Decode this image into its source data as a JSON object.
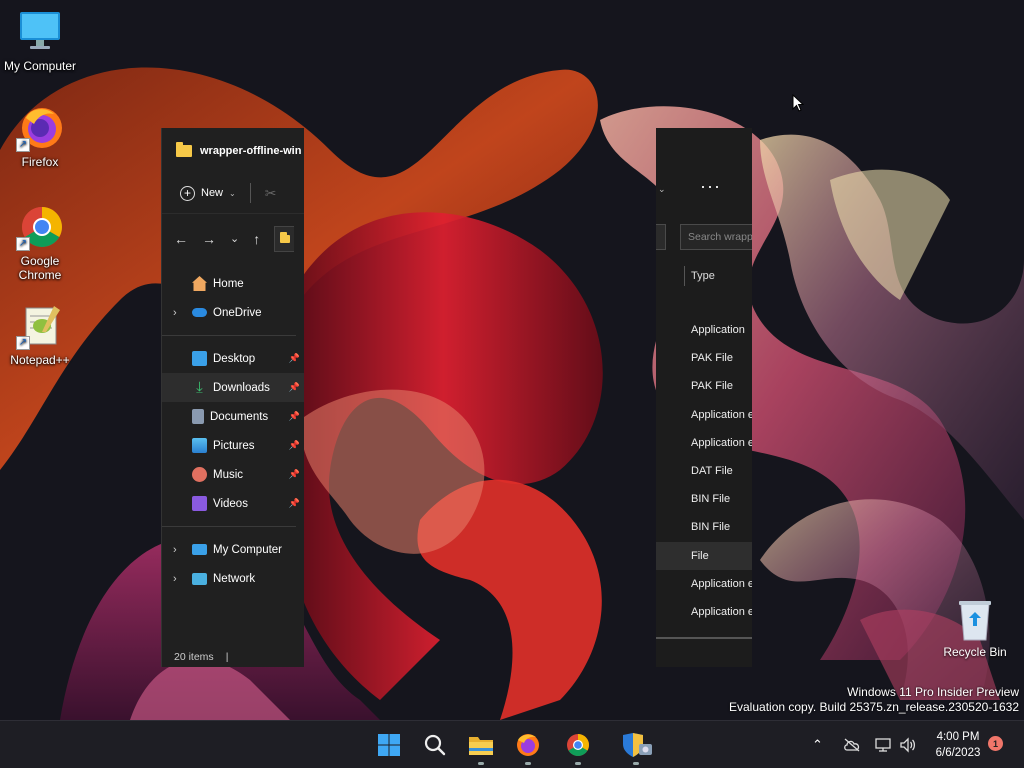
{
  "desktop": {
    "icons": [
      {
        "label": "My Computer"
      },
      {
        "label": "Firefox"
      },
      {
        "label": "Google\nChrome"
      },
      {
        "label": "Notepad++"
      }
    ],
    "recycle_bin_label": "Recycle Bin",
    "watermark": {
      "line1": "Windows 11 Pro Insider Preview",
      "line2": "Evaluation copy. Build 25375.zn_release.230520-1632"
    }
  },
  "explorer": {
    "title": "wrapper-offline-win",
    "toolbar": {
      "new_label": "New"
    },
    "nav": [
      {
        "label": "Home",
        "icon": "home-icon",
        "expander": false
      },
      {
        "label": "OneDrive",
        "icon": "cloud-icon",
        "expander": true
      },
      {
        "label": "Desktop",
        "icon": "desktop-folder-icon",
        "pinned": true
      },
      {
        "label": "Downloads",
        "icon": "downloads-icon",
        "pinned": true,
        "selected": true
      },
      {
        "label": "Documents",
        "icon": "documents-icon",
        "pinned": true
      },
      {
        "label": "Pictures",
        "icon": "pictures-icon",
        "pinned": true
      },
      {
        "label": "Music",
        "icon": "music-icon",
        "pinned": true
      },
      {
        "label": "Videos",
        "icon": "videos-icon",
        "pinned": true
      },
      {
        "label": "My Computer",
        "icon": "computer-icon",
        "expander": true
      },
      {
        "label": "Network",
        "icon": "network-icon",
        "expander": true
      }
    ],
    "status": "20 items",
    "search_placeholder": "Search wrapp",
    "column_header": "Type",
    "types": [
      "Application",
      "PAK File",
      "PAK File",
      "Application e",
      "Application e",
      "DAT File",
      "BIN File",
      "BIN File",
      "File",
      "Application e",
      "Application e"
    ],
    "highlighted_type_index": 8
  },
  "taskbar": {
    "clock_time": "4:00 PM",
    "clock_date": "6/6/2023",
    "notification_count": "1",
    "apps": [
      "start-icon",
      "search-icon",
      "file-explorer-icon",
      "firefox-icon",
      "chrome-icon",
      "security-admin-icon"
    ]
  },
  "colors": {
    "wallpaper_bg": "#15151d",
    "accent_orange": "#e8552a",
    "accent_red": "#c8202c",
    "explorer_bg": "#202020",
    "taskbar_bg": "#1e1e24"
  }
}
